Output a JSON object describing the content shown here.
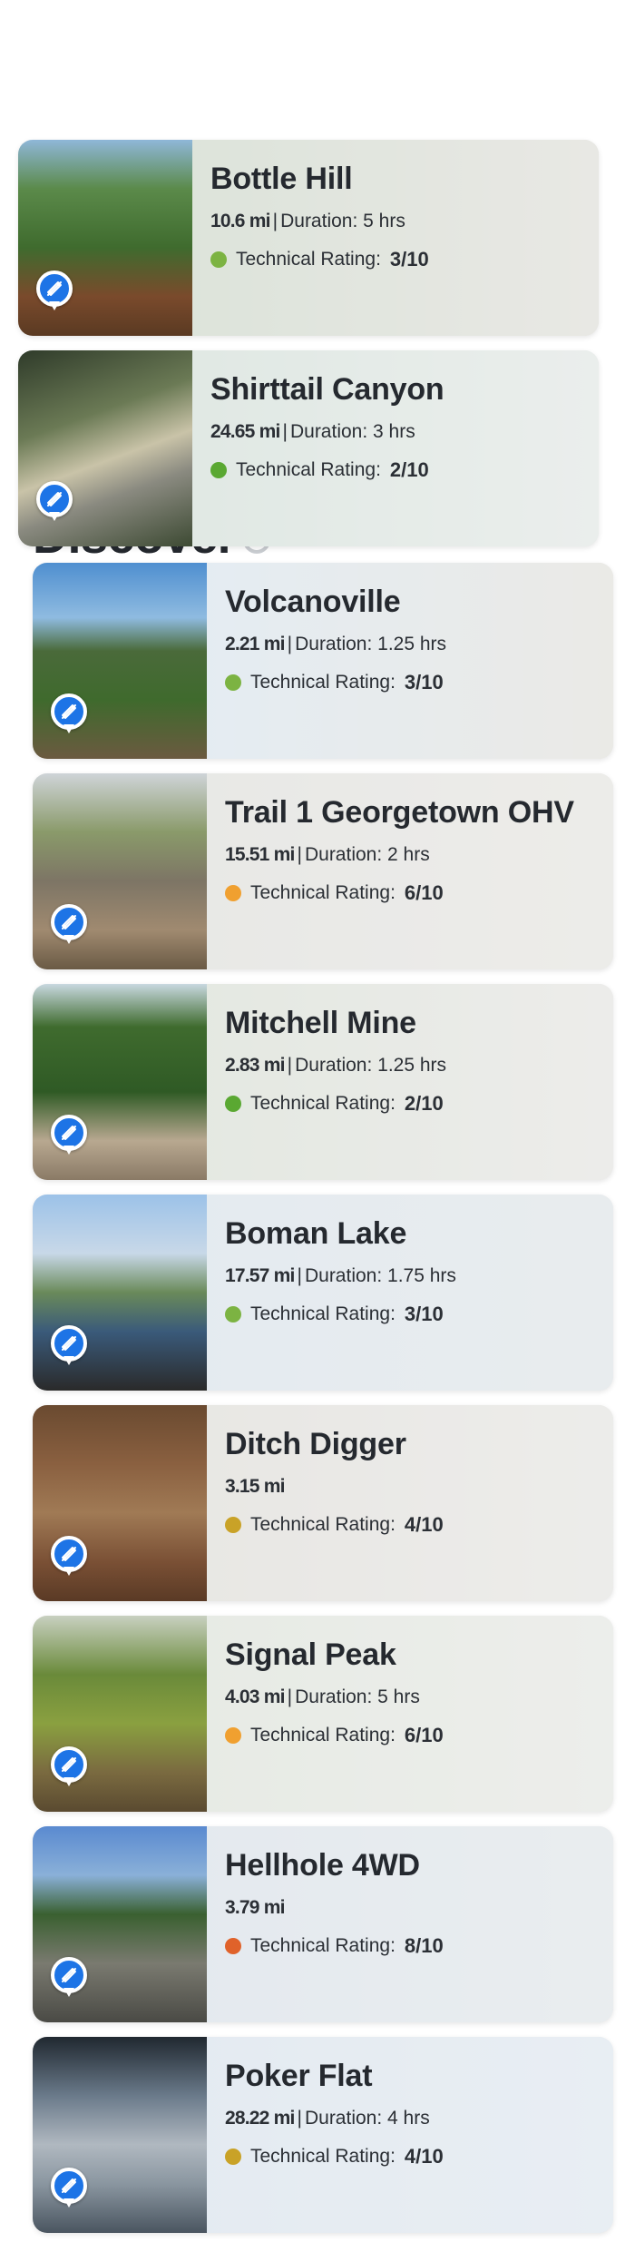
{
  "discover": {
    "heading": "Discover"
  },
  "duration_prefix": "Duration:",
  "rating_prefix": "Technical Rating:",
  "pinned_trails": [
    {
      "name": "Bottle Hill",
      "distance": "10.6 mi",
      "duration": "5 hrs",
      "rating": "3/10",
      "rating_color": "#7cb342",
      "photo": "forest-trail"
    },
    {
      "name": "Shirttail Canyon",
      "distance": "24.65 mi",
      "duration": "3 hrs",
      "rating": "2/10",
      "rating_color": "#5aa832",
      "photo": "jeep-trail"
    }
  ],
  "trails": [
    {
      "name": "Volcanoville",
      "distance": "2.21 mi",
      "duration": "1.25 hrs",
      "rating": "3/10",
      "rating_color": "#7cb342",
      "photo": "valley-view"
    },
    {
      "name": "Trail 1 Georgetown OHV",
      "distance": "15.51 mi",
      "duration": "2 hrs",
      "rating": "6/10",
      "rating_color": "#f0a030",
      "photo": "dirt-road-sign"
    },
    {
      "name": "Mitchell Mine",
      "distance": "2.83 mi",
      "duration": "1.25 hrs",
      "rating": "2/10",
      "rating_color": "#5aa832",
      "photo": "pine-road"
    },
    {
      "name": "Boman Lake",
      "distance": "17.57 mi",
      "duration": "1.75 hrs",
      "rating": "3/10",
      "rating_color": "#7cb342",
      "photo": "lake"
    },
    {
      "name": "Ditch Digger",
      "distance": "3.15 mi",
      "duration": "",
      "rating": "4/10",
      "rating_color": "#c9a227",
      "photo": "fallen-log"
    },
    {
      "name": "Signal Peak",
      "distance": "4.03 mi",
      "duration": "5 hrs",
      "rating": "6/10",
      "rating_color": "#f0a030",
      "photo": "hillside-sign"
    },
    {
      "name": "Hellhole 4WD",
      "distance": "3.79 mi",
      "duration": "",
      "rating": "8/10",
      "rating_color": "#e0622a",
      "photo": "rocky-lake"
    },
    {
      "name": "Poker Flat",
      "distance": "28.22 mi",
      "duration": "4 hrs",
      "rating": "4/10",
      "rating_color": "#c9a227",
      "photo": "cabin-porch"
    }
  ]
}
